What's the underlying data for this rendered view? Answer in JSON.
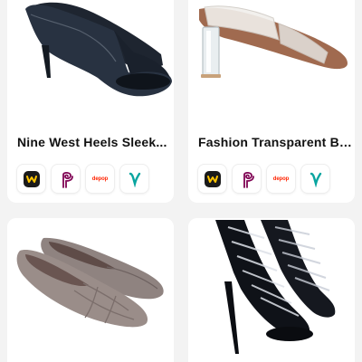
{
  "products": [
    {
      "title": "Nine West Heels Sleek...",
      "image": "black leather open-toe heel",
      "marketplaces": [
        {
          "name": "Mercari",
          "icon": "mercari-icon"
        },
        {
          "name": "Poshmark",
          "icon": "poshmark-icon"
        },
        {
          "name": "depop",
          "icon": "depop-icon",
          "label": "depop"
        },
        {
          "name": "Vinted",
          "icon": "vinted-icon"
        }
      ]
    },
    {
      "title": "Fashion Transparent Bl...",
      "image": "clear strap mule with clear block heel",
      "marketplaces": [
        {
          "name": "Mercari",
          "icon": "mercari-icon"
        },
        {
          "name": "Poshmark",
          "icon": "poshmark-icon"
        },
        {
          "name": "depop",
          "icon": "depop-icon",
          "label": "depop"
        },
        {
          "name": "Vinted",
          "icon": "vinted-icon"
        }
      ]
    },
    {
      "image": "taupe woven pointed-toe flats"
    },
    {
      "image": "black strappy stiletto sandal"
    }
  ],
  "colors": {
    "background": "#f3f3f3",
    "card": "#ffffff",
    "mercari": "#ffc400",
    "poshmark": "#7f0353",
    "depop": "#ff2300",
    "vinted": "#09a5a0"
  }
}
